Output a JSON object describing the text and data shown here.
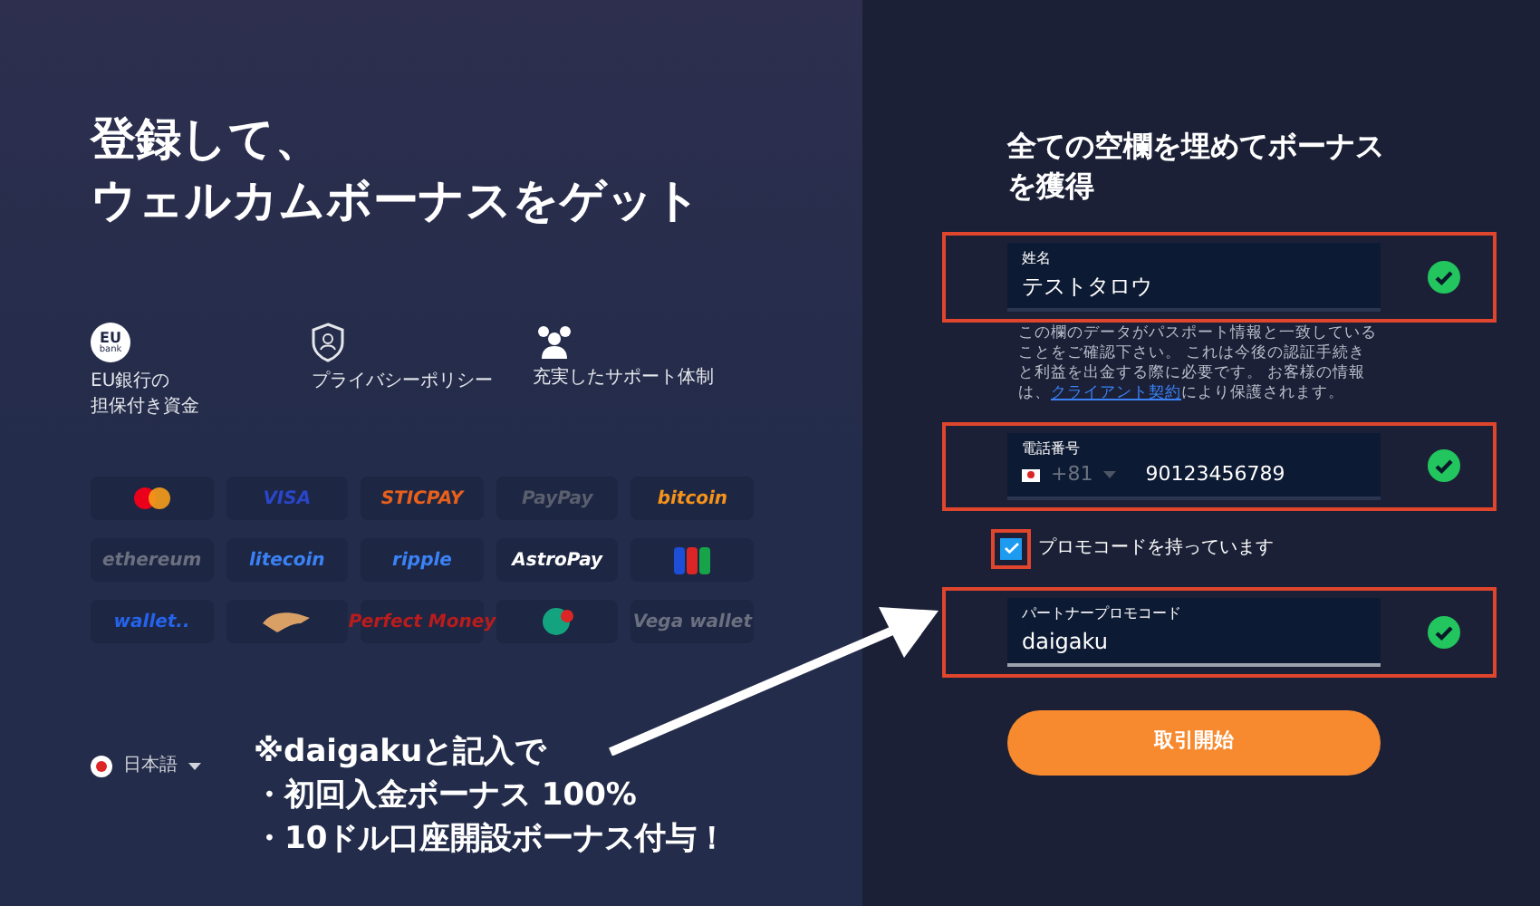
{
  "hero": {
    "title_lines": [
      "登録して、",
      "ウェルカムボーナスをゲット"
    ]
  },
  "features": [
    {
      "kind": "eu",
      "badge_top": "EU",
      "badge_bottom": "bank",
      "lines": [
        "EU銀行の",
        "担保付き資金"
      ]
    },
    {
      "kind": "shield",
      "lines": [
        "プライバシーポリシー"
      ]
    },
    {
      "kind": "people",
      "lines": [
        "充実したサポート体制"
      ]
    }
  ],
  "payments": [
    {
      "kind": "mastercard"
    },
    {
      "kind": "text",
      "label": "VISA",
      "color": "#2946c9"
    },
    {
      "kind": "text",
      "label": "STICPAY",
      "color": "#e8601c"
    },
    {
      "kind": "text",
      "label": "PayPay",
      "color": "#5a5f6e"
    },
    {
      "kind": "text",
      "label": "bitcoin",
      "color": "#f7931a"
    },
    {
      "kind": "text",
      "label": "ethereum",
      "color": "#6b7080"
    },
    {
      "kind": "text",
      "label": "litecoin",
      "color": "#3b82f6"
    },
    {
      "kind": "text",
      "label": "ripple",
      "color": "#3b82f6"
    },
    {
      "kind": "text",
      "label": "AstroPay",
      "color": "#ffffff"
    },
    {
      "kind": "jcb"
    },
    {
      "kind": "text",
      "label": "wallet..",
      "color": "#2563eb"
    },
    {
      "kind": "tiger"
    },
    {
      "kind": "text",
      "label": "Perfect Money",
      "color": "#b91c1c"
    },
    {
      "kind": "tcoin"
    },
    {
      "kind": "text",
      "label": "Vega wallet",
      "color": "#6b7080"
    }
  ],
  "language": {
    "label": "日本語"
  },
  "annotation": {
    "lines": [
      "※daigakuと記入で",
      "・初回入金ボーナス 100%",
      "・10ドル口座開設ボーナス付与！"
    ]
  },
  "form": {
    "title": "全ての空欄を埋めてボーナスを獲得",
    "name_field": {
      "label": "姓名",
      "value": "テストタロウ",
      "valid": true,
      "highlighted": true
    },
    "note": {
      "text": "この欄のデータがパスポート情報と一致していることをご確認下さい。 これは今後の認証手続きと利益を出金する際に必要です。 お客様の情報は、",
      "link": "クライアント契約",
      "after": "により保護されます。"
    },
    "phone_field": {
      "label": "電話番号",
      "code": "+81",
      "value": "90123456789",
      "valid": true,
      "highlighted": true
    },
    "promo_checkbox": {
      "label": "プロモコードを持っています",
      "checked": true,
      "highlighted": true
    },
    "promo_field": {
      "label": "パートナープロモコード",
      "value": "daigaku",
      "valid": true,
      "highlighted": true
    },
    "submit": {
      "label": "取引開始"
    }
  }
}
